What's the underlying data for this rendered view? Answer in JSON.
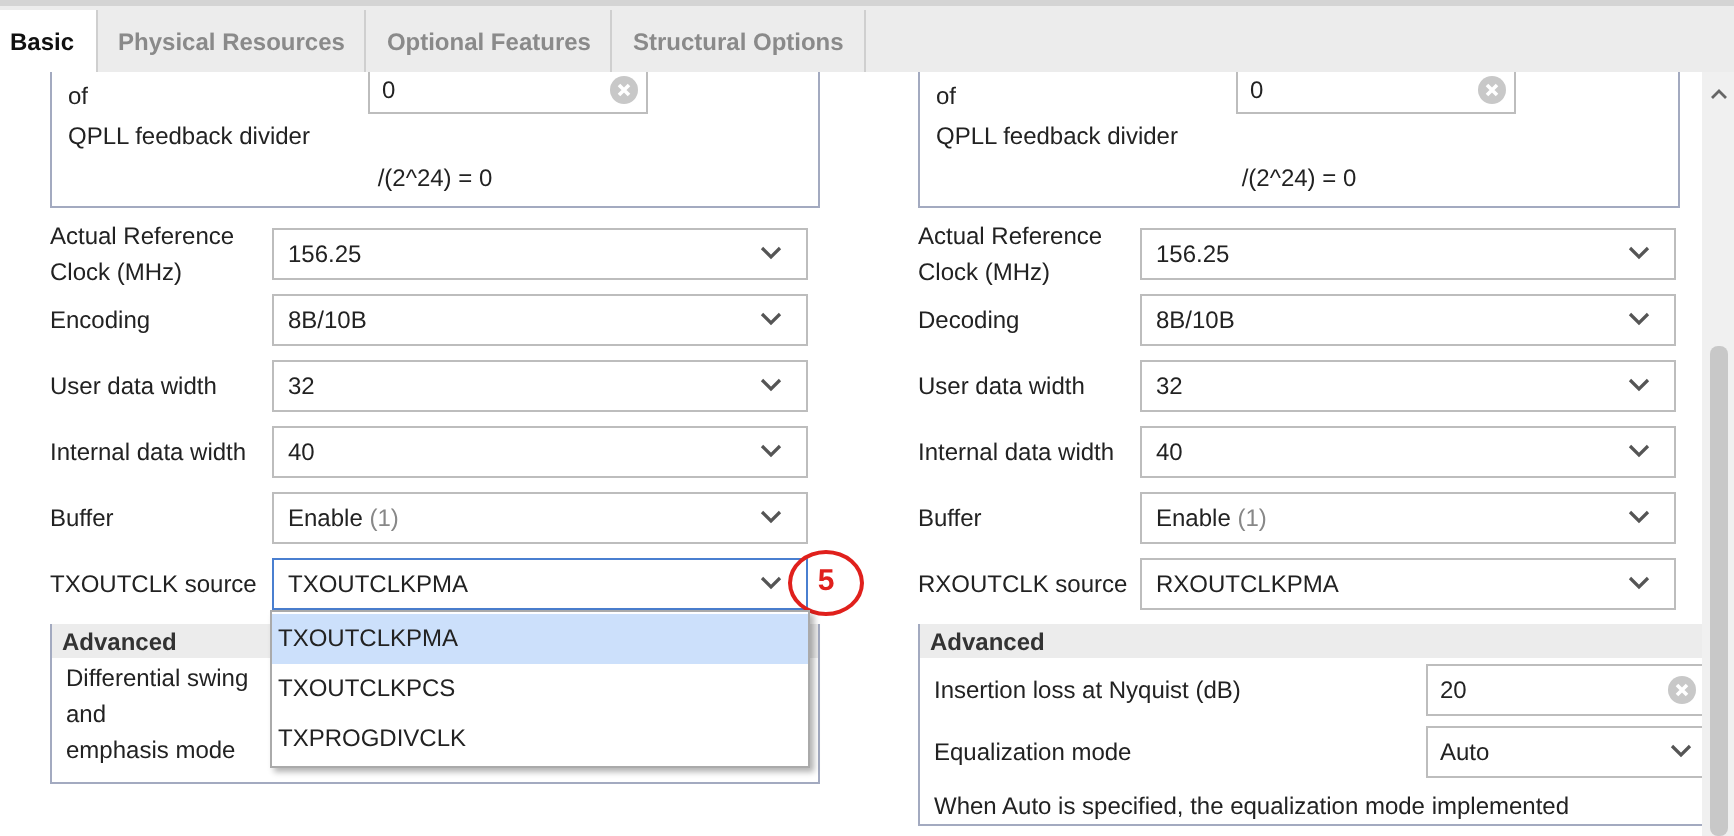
{
  "tabs": [
    {
      "label": "Basic",
      "selected": true
    },
    {
      "label": "Physical Resources",
      "selected": false
    },
    {
      "label": "Optional Features",
      "selected": false
    },
    {
      "label": "Structural Options",
      "selected": false
    }
  ],
  "columns": [
    {
      "qpll": {
        "label_lines": [
          "of",
          "QPLL feedback divider"
        ],
        "value": "0",
        "formula": "/(2^24) = 0"
      },
      "rows": [
        {
          "label": "Actual Reference Clock (MHz)",
          "value": "156.25",
          "focused": false
        },
        {
          "label": "Encoding",
          "value": "8B/10B",
          "focused": false
        },
        {
          "label": "User data width",
          "value": "32",
          "focused": false
        },
        {
          "label": "Internal data width",
          "value": "40",
          "focused": false
        },
        {
          "label": "Buffer",
          "value": "Enable",
          "hint": "(1)",
          "focused": false
        },
        {
          "label": "TXOUTCLK source",
          "value": "TXOUTCLKPMA",
          "focused": true,
          "annotation": "5",
          "options": [
            {
              "label": "TXOUTCLKPMA",
              "selected": true
            },
            {
              "label": "TXOUTCLKPCS",
              "selected": false
            },
            {
              "label": "TXPROGDIVCLK",
              "selected": false
            }
          ]
        }
      ],
      "advanced": {
        "title": "Advanced",
        "items": [
          {
            "kind": "label",
            "label": "Differential swing\nand\nemphasis mode"
          }
        ]
      }
    },
    {
      "qpll": {
        "label_lines": [
          "of",
          "QPLL feedback divider"
        ],
        "value": "0",
        "formula": "/(2^24) = 0"
      },
      "rows": [
        {
          "label": "Actual Reference Clock (MHz)",
          "value": "156.25",
          "focused": false
        },
        {
          "label": "Decoding",
          "value": "8B/10B",
          "focused": false
        },
        {
          "label": "User data width",
          "value": "32",
          "focused": false
        },
        {
          "label": "Internal data width",
          "value": "40",
          "focused": false
        },
        {
          "label": "Buffer",
          "value": "Enable",
          "hint": "(1)",
          "focused": false
        },
        {
          "label": "RXOUTCLK source",
          "value": "RXOUTCLKPMA",
          "focused": false
        }
      ],
      "advanced": {
        "title": "Advanced",
        "items": [
          {
            "kind": "text-field",
            "label": "Insertion loss at Nyquist (dB)",
            "value": "20"
          },
          {
            "kind": "select",
            "label": "Equalization mode",
            "value": "Auto"
          },
          {
            "kind": "note",
            "text": "When Auto is specified, the equalization mode implemented"
          }
        ]
      }
    }
  ]
}
